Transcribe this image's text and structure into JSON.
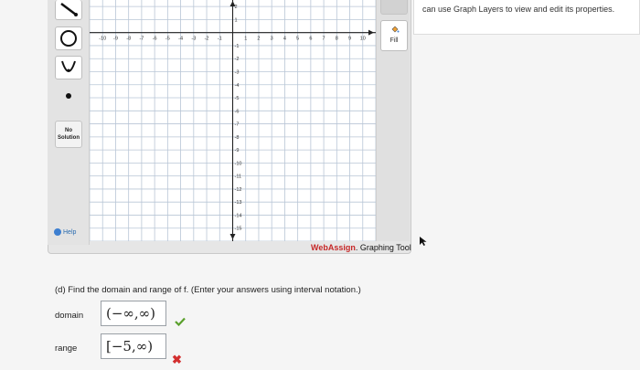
{
  "graph_tool": {
    "left_tools": [
      "line-tool",
      "circle-tool",
      "parabola-tool",
      "point-tool"
    ],
    "no_solution_label": "No Solution",
    "help_label": "Help",
    "fill_label": "Fill",
    "brand_name": "WebAssign",
    "brand_suffix": ". Graphing Tool",
    "x_tick_labels": [
      "-10",
      "-9",
      "-8",
      "-7",
      "-6",
      "-5",
      "-4",
      "-3",
      "-2",
      "-1",
      "1",
      "2",
      "3",
      "4",
      "5",
      "6",
      "7",
      "8",
      "9",
      "10"
    ],
    "y_tick_labels_positive": [
      "2",
      "1"
    ],
    "y_tick_labels_negative": [
      "-1",
      "-2",
      "-3",
      "-4",
      "-5",
      "-6",
      "-7",
      "-8",
      "-9",
      "-10",
      "-11",
      "-12",
      "-13",
      "-14",
      "-15"
    ],
    "x_range": [
      -11,
      11
    ],
    "y_range": [
      -16,
      2.5
    ]
  },
  "hint": {
    "text": "can use Graph Layers to view and edit its properties."
  },
  "question": {
    "text": "(d) Find the domain and range of f. (Enter your answers using interval notation.)",
    "domain_label": "domain",
    "domain_value": "(−∞,∞)",
    "domain_status": "correct",
    "range_label": "range",
    "range_value": "[−5,∞)",
    "range_status": "incorrect"
  },
  "colors": {
    "grid": "#b9c6d6",
    "correct": "#5aa02c",
    "incorrect": "#d32f2f",
    "brand": "#c62828"
  }
}
